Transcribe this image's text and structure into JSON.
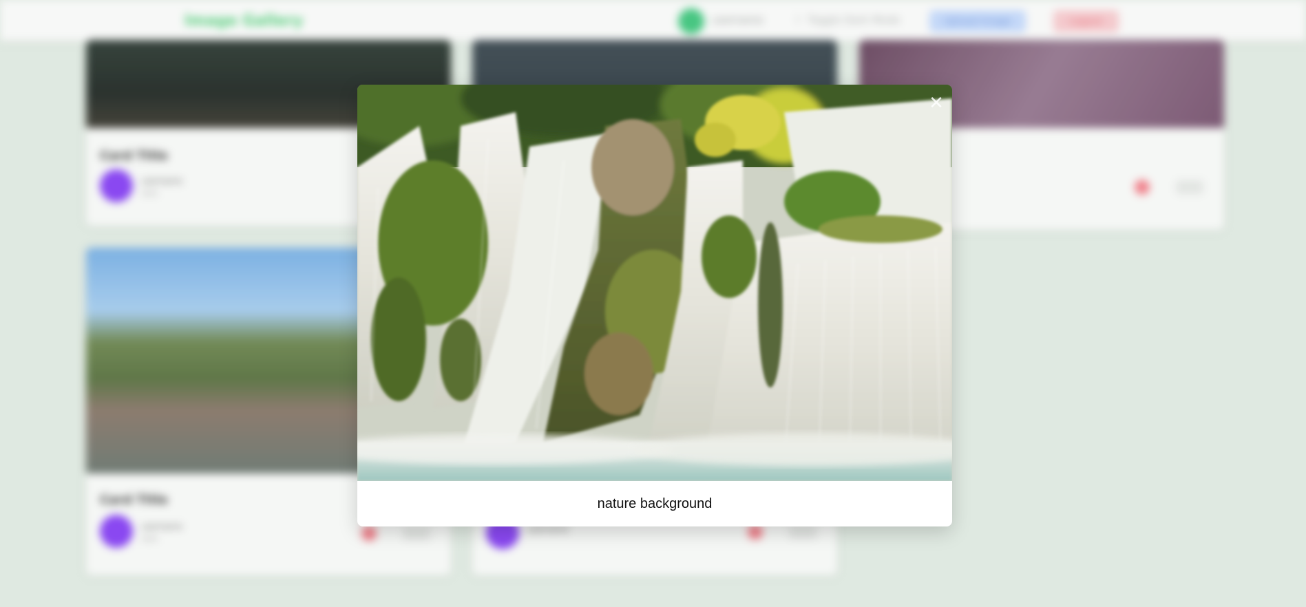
{
  "navbar": {
    "brand": "Image Gallery",
    "username": "username",
    "mode_toggle": "☾ Toggle Dark Mode",
    "upload_label": "Upload Image",
    "logout_label": "Logout"
  },
  "cards": [
    {
      "title": "Card Title",
      "author": "username",
      "date": "date"
    },
    {
      "title": "",
      "author": "",
      "date": ""
    },
    {
      "title": "",
      "author": "",
      "date": ""
    },
    {
      "title": "Card Title",
      "author": "username",
      "date": "date"
    },
    {
      "title": "",
      "author": "username",
      "date": ""
    }
  ],
  "modal": {
    "caption": "nature background",
    "close_icon": "close-icon",
    "close_glyph": "✕"
  },
  "colors": {
    "page_bg": "#dbe6dd",
    "brand": "#3ec66a",
    "avatar": "#7a2ff0",
    "upload": "#bcd3f7",
    "logout": "#f3c2c6"
  }
}
